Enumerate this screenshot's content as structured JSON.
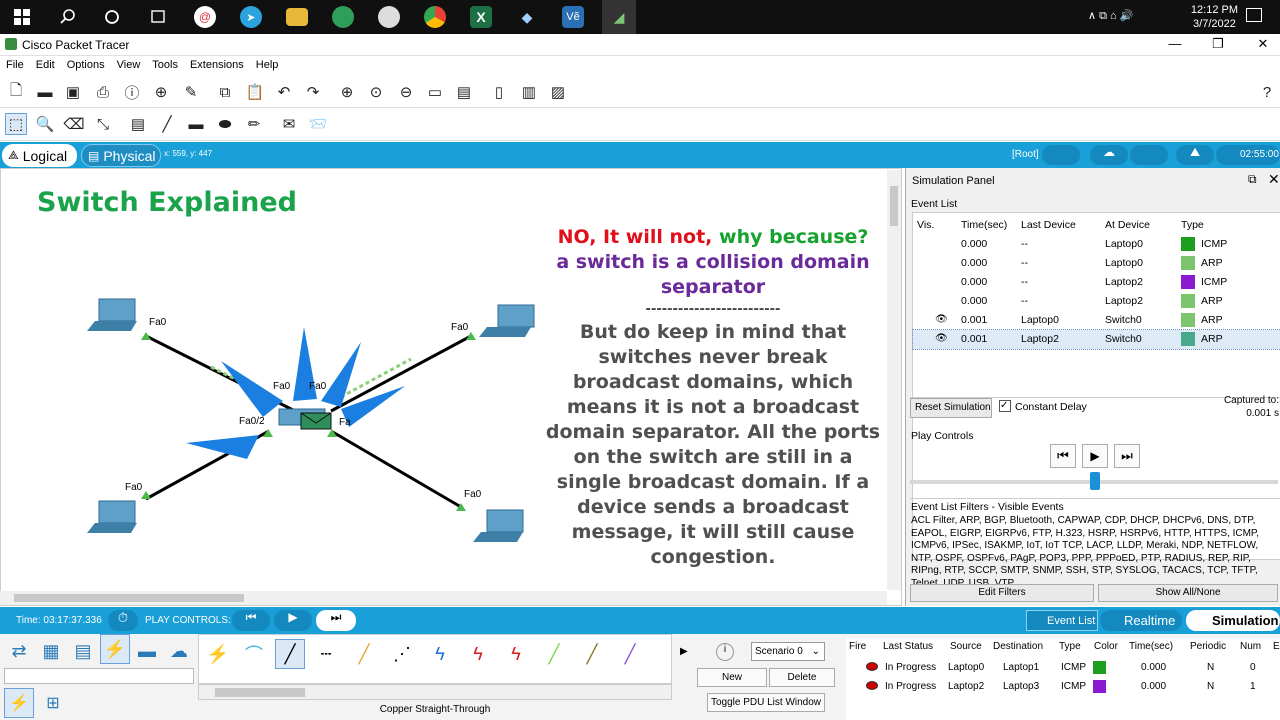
{
  "taskbar": {
    "time": "12:12 PM",
    "date": "3/7/2022"
  },
  "window": {
    "title": "Cisco Packet Tracer"
  },
  "menu": [
    "File",
    "Edit",
    "Options",
    "View",
    "Tools",
    "Extensions",
    "Help"
  ],
  "viewbar": {
    "logical": "Logical",
    "physical": "Physical",
    "coords": "x: 559, y: 447",
    "root": "[Root]",
    "clock": "02:55:00"
  },
  "canvas": {
    "title": "Switch Explained",
    "line1_a": "NO, It will not,",
    "line1_b": "why because?",
    "line2": "a switch is a collision domain",
    "line3": "separator",
    "divider": "-------------------------",
    "body": [
      "But do keep in mind that",
      "switches never break",
      "broadcast domains, which",
      "means it is not a broadcast",
      "domain separator. All the ports",
      "on the switch are still in a",
      "single broadcast domain. If a",
      "device sends a broadcast",
      "message, it will still cause",
      "congestion."
    ],
    "port_labels": {
      "tl": "Fa0",
      "tr": "Fa0",
      "bl": "Fa0",
      "br": "Fa0",
      "sw1": "Fa0/2",
      "sw2": "Fa0",
      "sw3": "Fa0",
      "sw4": "Fa"
    }
  },
  "sim": {
    "title": "Simulation Panel",
    "event_list_label": "Event List",
    "headers": [
      "Vis.",
      "Time(sec)",
      "Last Device",
      "At Device",
      "Type"
    ],
    "events": [
      {
        "time": "0.000",
        "last": "--",
        "at": "Laptop0",
        "type": "ICMP",
        "color": "#1e9e1e",
        "eye": false
      },
      {
        "time": "0.000",
        "last": "--",
        "at": "Laptop0",
        "type": "ARP",
        "color": "#7dc46e",
        "eye": false
      },
      {
        "time": "0.000",
        "last": "--",
        "at": "Laptop2",
        "type": "ICMP",
        "color": "#8a1bd0",
        "eye": false
      },
      {
        "time": "0.000",
        "last": "--",
        "at": "Laptop2",
        "type": "ARP",
        "color": "#7dc46e",
        "eye": false
      },
      {
        "time": "0.001",
        "last": "Laptop0",
        "at": "Switch0",
        "type": "ARP",
        "color": "#7dc46e",
        "eye": true
      },
      {
        "time": "0.001",
        "last": "Laptop2",
        "at": "Switch0",
        "type": "ARP",
        "color": "#4aa88a",
        "eye": true
      }
    ],
    "reset_label": "Reset Simulation",
    "constant_delay": "Constant Delay",
    "captured_label": "Captured to:",
    "captured_value": "0.001 s",
    "play_controls": "Play Controls",
    "filters_title": "Event List Filters - Visible Events",
    "filters_text": "ACL Filter, ARP, BGP, Bluetooth, CAPWAP, CDP, DHCP, DHCPv6, DNS, DTP, EAPOL, EIGRP, EIGRPv6, FTP, H.323, HSRP, HSRPv6, HTTP, HTTPS, ICMP, ICMPv6, IPSec, ISAKMP, IoT, IoT TCP, LACP, LLDP, Meraki, NDP, NETFLOW, NTP, OSPF, OSPFv6, PAgP, POP3, PPP, PPPoED, PTP, RADIUS, REP, RIP, RIPng, RTP, SCCP, SMTP, SNMP, SSH, STP, SYSLOG, TACACS, TCP, TFTP, Telnet, UDP, USB, VTP",
    "edit_filters": "Edit Filters",
    "show_all": "Show All/None"
  },
  "timebar": {
    "time": "Time: 03:17:37.336",
    "play_controls": "PLAY CONTROLS:",
    "event_list": "Event List",
    "realtime": "Realtime",
    "simulation": "Simulation"
  },
  "bottom": {
    "cable_label": "Copper Straight-Through",
    "scenario": "Scenario 0",
    "new": "New",
    "delete": "Delete",
    "toggle": "Toggle PDU List Window",
    "pdu_headers": [
      "Fire",
      "Last Status",
      "Source",
      "Destination",
      "Type",
      "Color",
      "Time(sec)",
      "Periodic",
      "Num",
      "E"
    ],
    "pdu_rows": [
      {
        "status": "In Progress",
        "src": "Laptop0",
        "dst": "Laptop1",
        "type": "ICMP",
        "color": "#1e9e1e",
        "time": "0.000",
        "periodic": "N",
        "num": "0"
      },
      {
        "status": "In Progress",
        "src": "Laptop2",
        "dst": "Laptop3",
        "type": "ICMP",
        "color": "#8a1bd0",
        "time": "0.000",
        "periodic": "N",
        "num": "1"
      }
    ]
  }
}
